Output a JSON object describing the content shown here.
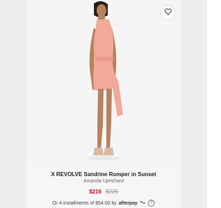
{
  "product": {
    "title": "X REVOLVE Sandrine Romper in Sunset",
    "brand": "Amanda Uprichard",
    "sale_price": "$216",
    "original_price": "$229",
    "installments_text": "Or 4 installments of $54.00 by",
    "afterpay_label": "afterpay",
    "info_glyph": "?"
  },
  "colors": {
    "garment": "#f2a99a",
    "sale_price": "#d0021b"
  },
  "icons": {
    "favorite": "heart-icon",
    "afterpay": "afterpay-loop-icon",
    "info": "info-icon"
  }
}
